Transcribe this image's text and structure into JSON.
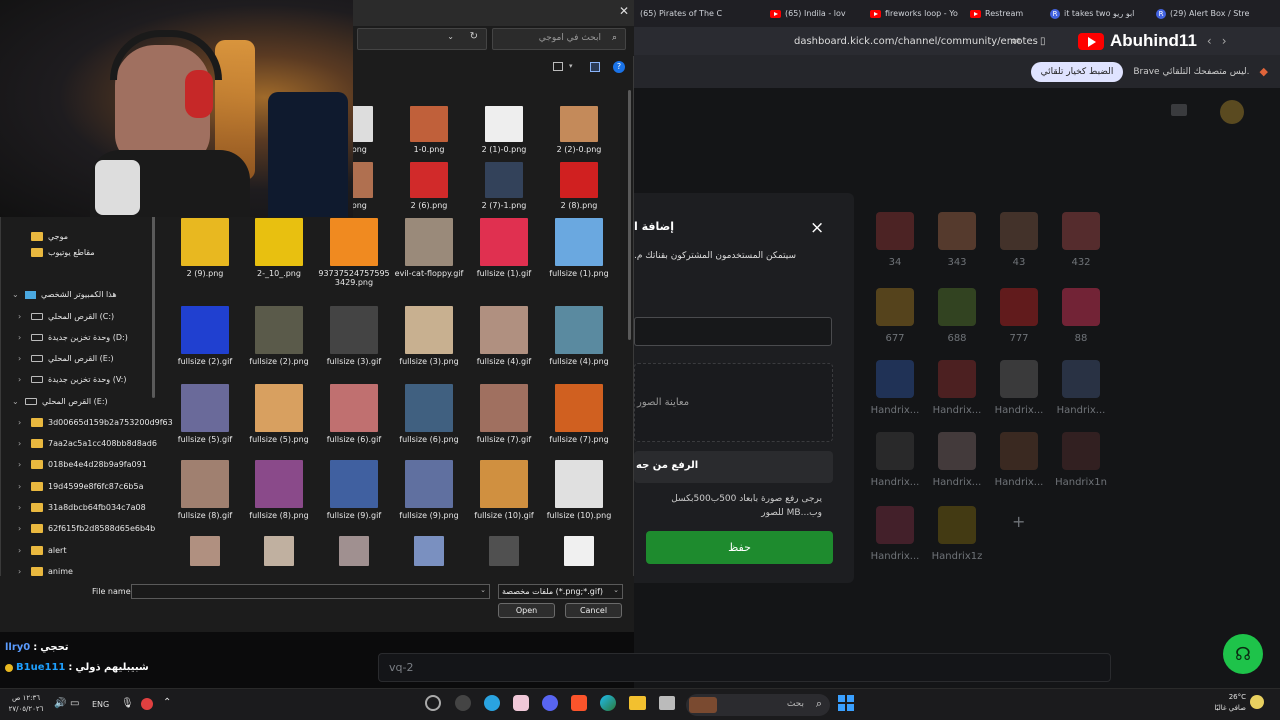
{
  "browser": {
    "tabs": [
      {
        "label": "(65) Pirates of The C",
        "icon": "youtube-icon"
      },
      {
        "label": "(65) Indila - lov",
        "icon": "youtube-icon"
      },
      {
        "label": "fireworks loop - Yo",
        "icon": "youtube-icon"
      },
      {
        "label": "Restream",
        "icon": "youtube-icon"
      },
      {
        "label": "it takes two ابو ريو",
        "icon": "restream-icon"
      },
      {
        "label": "(29) Alert Box / Stre",
        "icon": "restream-icon"
      }
    ],
    "address": "dashboard.kick.com/channel/community/emotes",
    "notification_text": "Brave ليس متصفحك التلقائي.",
    "notification_button": "الضبط كخيار تلقائي",
    "channel_overlay": "Abuhind11"
  },
  "kick": {
    "modal_title": "إضافة الم",
    "modal_subtitle": "سيتمكن المستخدمون المشتركون بقناتك م.",
    "modal_preview": "معاينة الصور",
    "modal_upload": "الرفع من جه",
    "modal_hint": "يرجى رفع صورة بابعاد 500ب500بكسل وب...MB للصور",
    "modal_save": "حفظ",
    "close_icon": "×",
    "emote_labels": [
      "34",
      "343",
      "43",
      "432",
      "677",
      "688",
      "777",
      "88",
      "Handrix...",
      "Handrix...",
      "Handrix...",
      "Handrix...",
      "Handrix...",
      "Handrix...",
      "Handrix...",
      "Handrix1n",
      "Handrix...",
      "Handrix1z"
    ],
    "add_icon": "+",
    "chat_placeholder": "vq-2"
  },
  "dialog": {
    "search_placeholder": "ابحث في اموجي",
    "sidebar": [
      {
        "label": "موجي",
        "type": "folder",
        "indent": 1
      },
      {
        "label": "مقاطع يوتيوب",
        "type": "folder",
        "indent": 1
      },
      {
        "label": "هذا الكمبيوتر الشخصي",
        "type": "pc",
        "indent": 0
      },
      {
        "label": "القرص المحلي (C:)",
        "type": "drive",
        "indent": 1
      },
      {
        "label": "وحدة تخزين جديدة (D:)",
        "type": "drive",
        "indent": 1
      },
      {
        "label": "القرص المحلي (E:)",
        "type": "drive",
        "indent": 1
      },
      {
        "label": "وحدة تخزين جديدة (V:)",
        "type": "drive",
        "indent": 1
      },
      {
        "label": "القرص المحلي (E:)",
        "type": "drive",
        "indent": 0
      },
      {
        "label": "3d00665d159b2a753200d9f63",
        "type": "folder",
        "indent": 1
      },
      {
        "label": "7aa2ac5a1cc408bb8d8ad6",
        "type": "folder",
        "indent": 1
      },
      {
        "label": "018be4e4d28b9a9fa091",
        "type": "folder",
        "indent": 1
      },
      {
        "label": "19d4599e8f6fc87c6b5a",
        "type": "folder",
        "indent": 1
      },
      {
        "label": "31a8dbcb64fb034c7a08",
        "type": "folder",
        "indent": 1
      },
      {
        "label": "62f615fb2d8588d65e6b4b",
        "type": "folder",
        "indent": 1
      },
      {
        "label": "alert",
        "type": "folder",
        "indent": 1
      },
      {
        "label": "anime",
        "type": "folder",
        "indent": 1
      }
    ],
    "files": [
      {
        "name": "-0.png",
        "color": "#dddddd"
      },
      {
        "name": "1-0.png",
        "color": "#c0603a"
      },
      {
        "name": "2 (1)-0.png",
        "color": "#eeeeee"
      },
      {
        "name": "2 (2)-0.png",
        "color": "#c48a5a"
      },
      {
        "name": "-0.png",
        "color": "#b07050"
      },
      {
        "name": "2 (6).png",
        "color": "#d12a2a"
      },
      {
        "name": "2 (7)-1.png",
        "color": "#33425a"
      },
      {
        "name": "2 (8).png",
        "color": "#d02020"
      },
      {
        "name": "2 (9).png",
        "color": "#e8b820"
      },
      {
        "name": "2-_10_.png",
        "color": "#e8c010"
      },
      {
        "name": "937375247575953429.png",
        "color": "#f08a20"
      },
      {
        "name": "evil-cat-floppy.gif",
        "color": "#9a8a7a"
      },
      {
        "name": "fullsize (1).gif",
        "color": "#e03050"
      },
      {
        "name": "fullsize (1).png",
        "color": "#6aa8e0"
      },
      {
        "name": "fullsize (2).gif",
        "color": "#2040d0"
      },
      {
        "name": "fullsize (2).png",
        "color": "#5a5a4a"
      },
      {
        "name": "fullsize (3).gif",
        "color": "#444444"
      },
      {
        "name": "fullsize (3).png",
        "color": "#c8b090"
      },
      {
        "name": "fullsize (4).gif",
        "color": "#b09080"
      },
      {
        "name": "fullsize (4).png",
        "color": "#5a8aa0"
      },
      {
        "name": "fullsize (5).gif",
        "color": "#6a6a9a"
      },
      {
        "name": "fullsize (5).png",
        "color": "#d8a060"
      },
      {
        "name": "fullsize (6).gif",
        "color": "#c07070"
      },
      {
        "name": "fullsize (6).png",
        "color": "#406080"
      },
      {
        "name": "fullsize (7).gif",
        "color": "#a07060"
      },
      {
        "name": "fullsize (7).png",
        "color": "#d06020"
      },
      {
        "name": "fullsize (8).gif",
        "color": "#a08070"
      },
      {
        "name": "fullsize (8).png",
        "color": "#8a4a8a"
      },
      {
        "name": "fullsize (9).gif",
        "color": "#4060a0"
      },
      {
        "name": "fullsize (9).png",
        "color": "#6070a0"
      },
      {
        "name": "fullsize (10).gif",
        "color": "#d09040"
      },
      {
        "name": "fullsize (10).png",
        "color": "#e0e0e0"
      },
      {
        "name": "",
        "color": "#b09080"
      },
      {
        "name": "",
        "color": "#c0b0a0"
      },
      {
        "name": "",
        "color": "#a09090"
      },
      {
        "name": "",
        "color": "#7a90c0"
      },
      {
        "name": "",
        "color": "#505050"
      },
      {
        "name": "",
        "color": "#f0f0f0"
      }
    ],
    "file_name_label": "File name:",
    "file_name_value": "",
    "filter_value": "ملفات مخصصة (*.png;*.gif)",
    "open_button": "Open",
    "cancel_button": "Cancel"
  },
  "stream_chat": [
    {
      "user": "llry0",
      "text": "تحجي",
      "user_color": "#5b9cff"
    },
    {
      "user": "B1ue111",
      "text": "شبيبليهم ذولي",
      "user_color": "#1ea0ff"
    }
  ],
  "taskbar": {
    "weather_temp": "26°C",
    "weather_text": "صافي غالبًا",
    "search_placeholder": "بحث",
    "lang": "ENG",
    "time": "١٢:٣٦ ص",
    "date": "٢٧/٠٥/٢٠٢٦"
  }
}
